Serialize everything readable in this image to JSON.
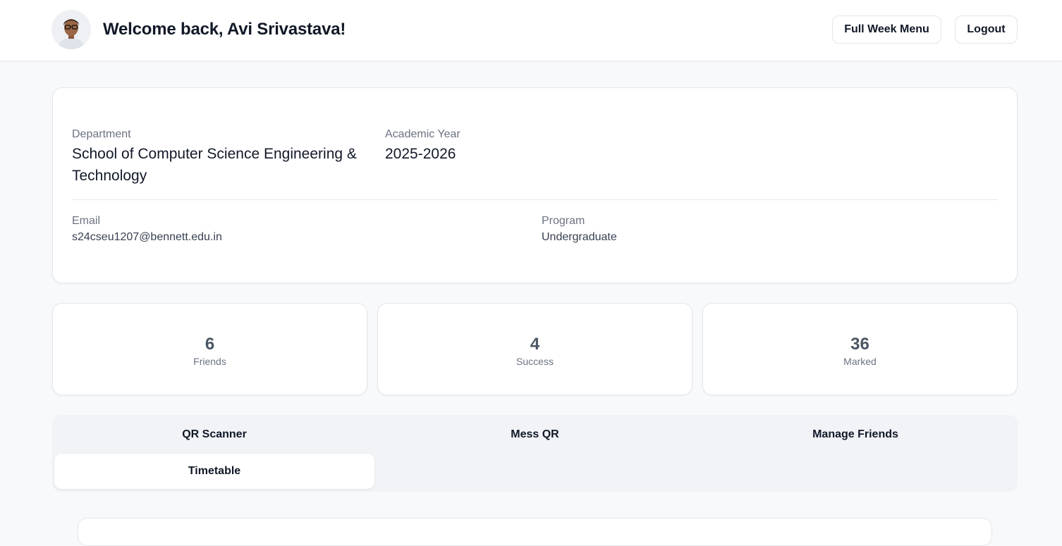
{
  "header": {
    "welcome_text": "Welcome back, Avi Srivastava!",
    "full_week_menu_label": "Full Week Menu",
    "logout_label": "Logout"
  },
  "profile": {
    "department_label": "Department",
    "department_value": "School of Computer Science Engineering & Technology",
    "academic_year_label": "Academic Year",
    "academic_year_value": "2025-2026",
    "email_label": "Email",
    "email_value": "s24cseu1207@bennett.edu.in",
    "program_label": "Program",
    "program_value": "Undergraduate"
  },
  "stats": [
    {
      "value": "6",
      "label": "Friends"
    },
    {
      "value": "4",
      "label": "Success"
    },
    {
      "value": "36",
      "label": "Marked"
    }
  ],
  "tabs": [
    {
      "label": "QR Scanner",
      "active": false
    },
    {
      "label": "Mess QR",
      "active": false
    },
    {
      "label": "Manage Friends",
      "active": false
    },
    {
      "label": "Timetable",
      "active": true
    }
  ],
  "colors": {
    "page_bg": "#f8f9fb",
    "card_bg": "#ffffff",
    "border": "#e5e7eb",
    "muted_text": "#6b7280",
    "tab_bar_bg": "#f1f3f6"
  }
}
